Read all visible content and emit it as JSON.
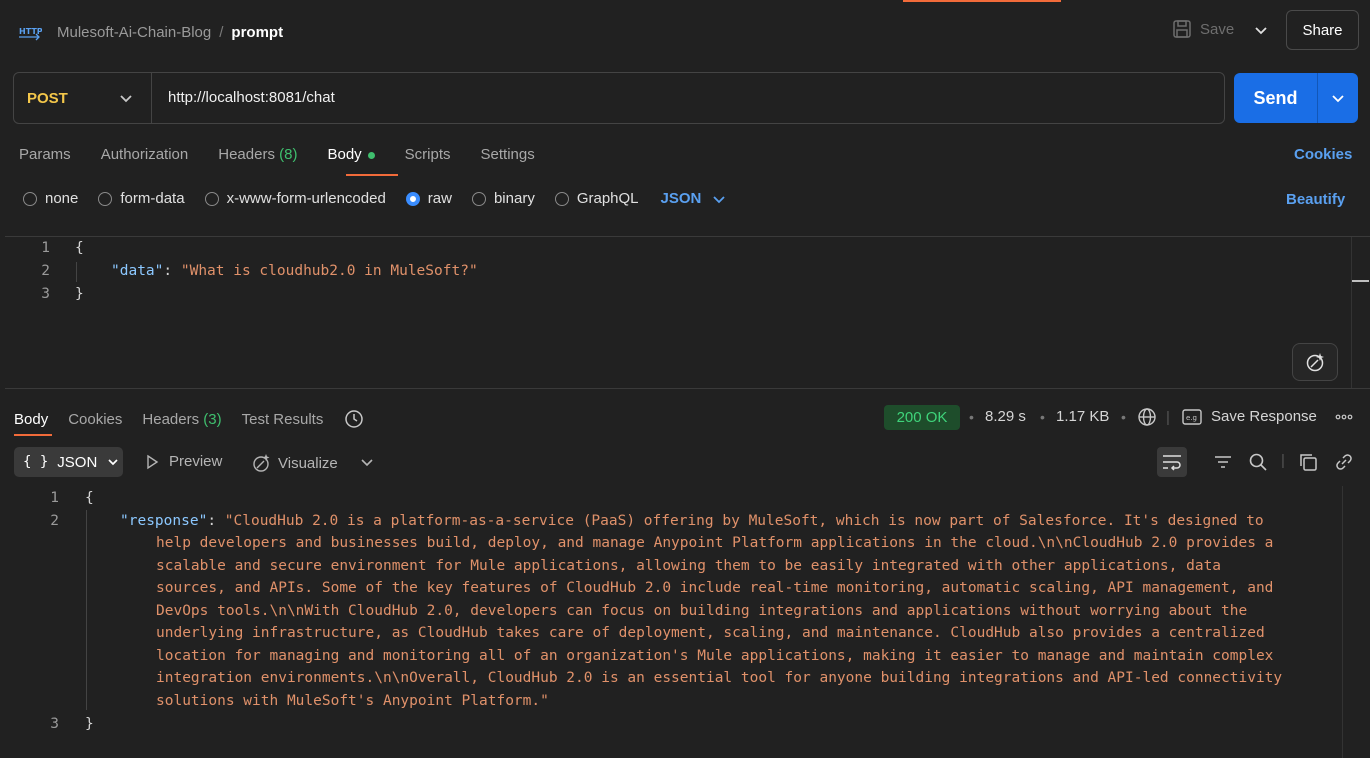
{
  "header": {
    "collection": "Mulesoft-Ai-Chain-Blog",
    "separator": "/",
    "request_name": "prompt",
    "save_label": "Save",
    "share_label": "Share"
  },
  "request": {
    "method": "POST",
    "url": "http://localhost:8081/chat",
    "send_label": "Send",
    "tabs": [
      {
        "label": "Params"
      },
      {
        "label": "Authorization"
      },
      {
        "label": "Headers",
        "count": "(8)"
      },
      {
        "label": "Body"
      },
      {
        "label": "Scripts"
      },
      {
        "label": "Settings"
      }
    ],
    "cookies_label": "Cookies",
    "body_types": [
      "none",
      "form-data",
      "x-www-form-urlencoded",
      "raw",
      "binary",
      "GraphQL"
    ],
    "selected_body_type": "raw",
    "language": "JSON",
    "beautify_label": "Beautify",
    "code": {
      "line_numbers": [
        "1",
        "2",
        "3"
      ],
      "open_brace": "{",
      "key": "\"data\"",
      "colon": ": ",
      "value": "\"What is cloudhub2.0 in MuleSoft?\"",
      "close_brace": "}"
    }
  },
  "response": {
    "tabs": [
      {
        "label": "Body"
      },
      {
        "label": "Cookies"
      },
      {
        "label": "Headers",
        "count": "(3)"
      },
      {
        "label": "Test Results"
      }
    ],
    "status": "200 OK",
    "time": "8.29 s",
    "size": "1.17 KB",
    "save_response_label": "Save Response",
    "format": "JSON",
    "preview_label": "Preview",
    "visualize_label": "Visualize",
    "code": {
      "line_numbers": [
        "1",
        "2",
        "3"
      ],
      "open_brace": "{",
      "key": "\"response\"",
      "colon": ": ",
      "value_first_line": "\"CloudHub 2.0 is a platform-as-a-service (PaaS) offering by MuleSoft, which is now part of Salesforce. It's designed to",
      "value_wrapped": "help developers and businesses build, deploy, and manage Anypoint Platform applications in the cloud.\\n\\nCloudHub 2.0 provides a\nscalable and secure environment for Mule applications, allowing them to be easily integrated with other applications, data\nsources, and APIs. Some of the key features of CloudHub 2.0 include real-time monitoring, automatic scaling, API management, and\nDevOps tools.\\n\\nWith CloudHub 2.0, developers can focus on building integrations and applications without worrying about the\nunderlying infrastructure, as CloudHub takes care of deployment, scaling, and maintenance. CloudHub also provides a centralized\nlocation for managing and monitoring all of an organization's Mule applications, making it easier to manage and maintain complex\nintegration environments.\\n\\nOverall, CloudHub 2.0 is an essential tool for anyone building integrations and API-led connectivity\nsolutions with MuleSoft's Anypoint Platform.\"",
      "close_brace": "}"
    }
  },
  "colors": {
    "accent": "#f26b3a",
    "send": "#1a6ee6",
    "method": "#f4c74a",
    "link": "#5aa0f0",
    "status_ok": "#3fd37a",
    "json_key": "#8cc8ff",
    "json_string": "#e0916a"
  },
  "icons": [
    "http-icon",
    "save-icon",
    "chevron-down-icon",
    "history-icon",
    "globe-icon",
    "save-response-icon",
    "more-icon",
    "play-icon",
    "visualize-icon",
    "wrap-icon",
    "filter-icon",
    "search-icon",
    "copy-icon",
    "link-icon",
    "magic-icon"
  ]
}
